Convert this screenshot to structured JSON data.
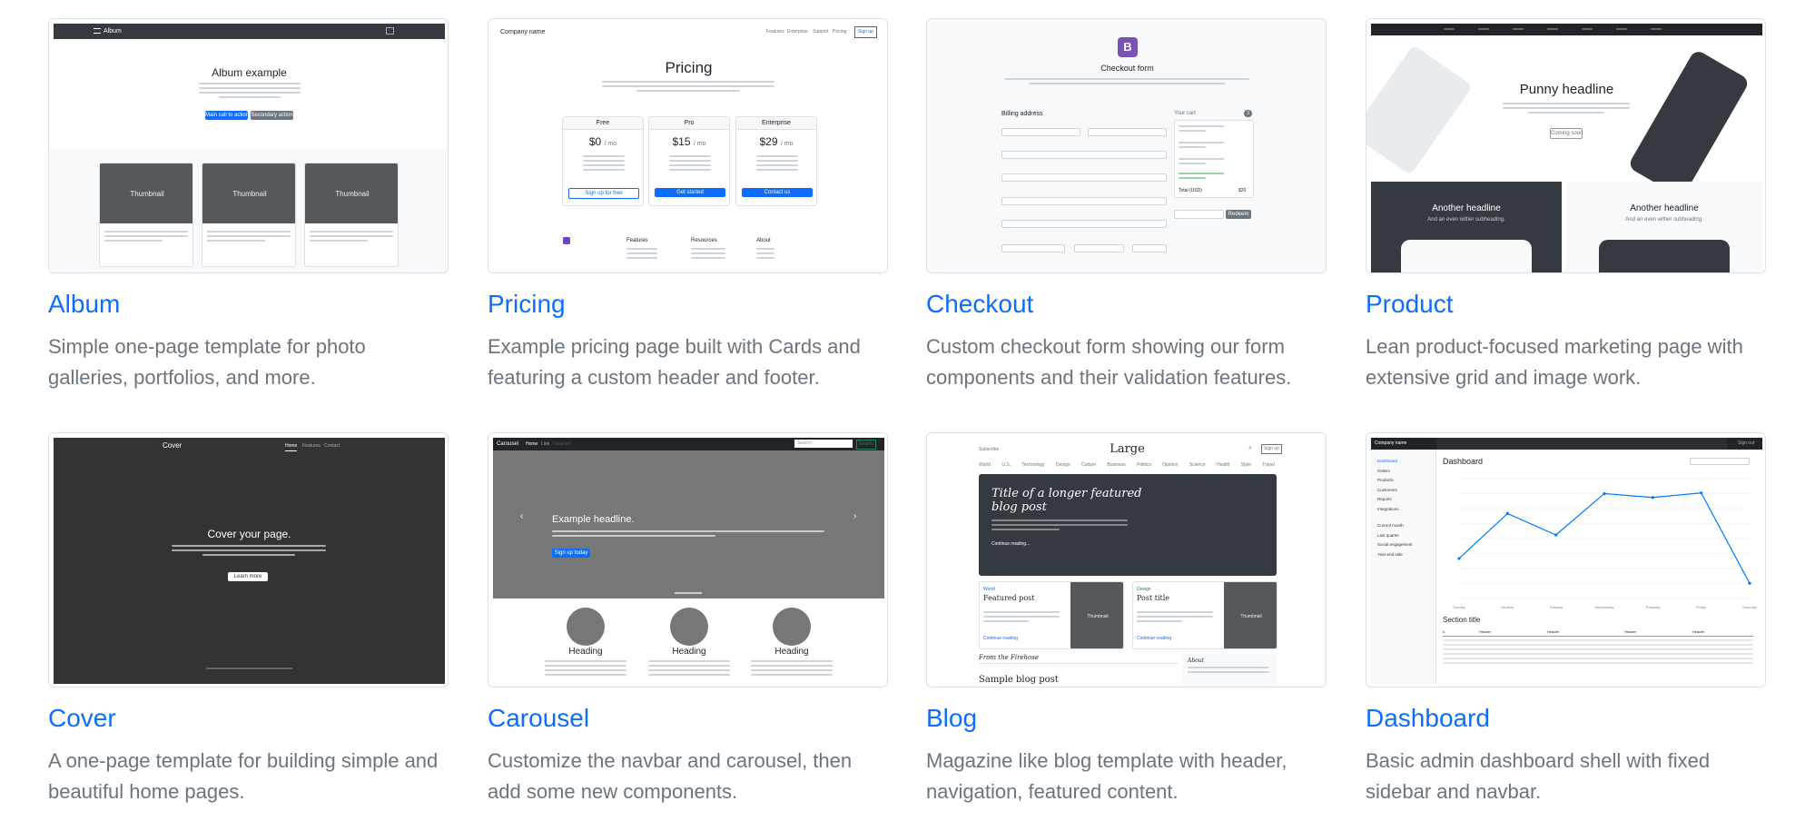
{
  "templates": [
    {
      "title": "Album",
      "description": "Simple one-page template for photo galleries, portfolios, and more."
    },
    {
      "title": "Pricing",
      "description": "Example pricing page built with Cards and featuring a custom header and footer."
    },
    {
      "title": "Checkout",
      "description": "Custom checkout form showing our form components and their validation features."
    },
    {
      "title": "Product",
      "description": "Lean product-focused marketing page with extensive grid and image work."
    },
    {
      "title": "Cover",
      "description": "A one-page template for building simple and beautiful home pages."
    },
    {
      "title": "Carousel",
      "description": "Customize the navbar and carousel, then add some new components."
    },
    {
      "title": "Blog",
      "description": "Magazine like blog template with header, navigation, featured content."
    },
    {
      "title": "Dashboard",
      "description": "Basic admin dashboard shell with fixed sidebar and navbar."
    }
  ],
  "previews": {
    "album": {
      "brand": "Album",
      "heading": "Album example",
      "btn1": "Main call to action",
      "btn2": "Secondary action",
      "thumb_label": "Thumbnail"
    },
    "pricing": {
      "brand": "Company name",
      "nav": [
        "Features",
        "Enterprise",
        "Support",
        "Pricing"
      ],
      "signup": "Sign up",
      "heading": "Pricing",
      "plans": [
        {
          "name": "Free",
          "price": "$0",
          "per": "/ mo",
          "cta": "Sign up for free"
        },
        {
          "name": "Pro",
          "price": "$15",
          "per": "/ mo",
          "cta": "Get started"
        },
        {
          "name": "Enterprise",
          "price": "$29",
          "per": "/ mo",
          "cta": "Contact us"
        }
      ],
      "footer": [
        "Features",
        "Resources",
        "About"
      ]
    },
    "checkout": {
      "heading": "Checkout form",
      "billing": "Billing address",
      "cart": "Your cart",
      "cart_count": "3",
      "total_label": "Total (USD)",
      "total": "$20",
      "redeem": "Redeem"
    },
    "product": {
      "heading": "Punny headline",
      "btn": "Coming soon",
      "h1": "Another headline",
      "h2": "Another headline",
      "sub": "And an even wittier subheading."
    },
    "cover": {
      "brand": "Cover",
      "nav": [
        "Home",
        "Features",
        "Contact"
      ],
      "heading": "Cover your page.",
      "btn": "Learn more"
    },
    "carousel": {
      "brand": "Carousel",
      "nav": [
        "Home",
        "Link",
        "Disabled"
      ],
      "search": "Search",
      "search_btn": "Search",
      "headline": "Example headline.",
      "btn": "Sign up today",
      "heading": "Heading"
    },
    "blog": {
      "brand": "Large",
      "subscribe": "Subscribe",
      "signup": "Sign up",
      "nav": [
        "World",
        "U.S.",
        "Technology",
        "Design",
        "Culture",
        "Business",
        "Politics",
        "Opinion",
        "Science",
        "Health",
        "Style",
        "Travel"
      ],
      "hero_title": "Title of a longer featured blog post",
      "hero_link": "Continue reading...",
      "post1_tag": "World",
      "post1": "Featured post",
      "post2_tag": "Design",
      "post2": "Post title",
      "thumb": "Thumbnail",
      "continue": "Continue reading",
      "firehose": "From the Firehose",
      "sample": "Sample blog post",
      "about": "About"
    },
    "dashboard": {
      "brand": "Company name",
      "signout": "Sign out",
      "heading": "Dashboard",
      "section": "Section title",
      "sidebar": [
        "Dashboard",
        "Orders",
        "Products",
        "Customers",
        "Reports",
        "Integrations"
      ],
      "saved": [
        "Current month",
        "Last quarter",
        "Social engagement",
        "Year-end sale"
      ],
      "header_cells": [
        "#",
        "Header",
        "Header",
        "Header",
        "Header"
      ],
      "days": [
        "Sunday",
        "Monday",
        "Tuesday",
        "Wednesday",
        "Thursday",
        "Friday",
        "Saturday"
      ],
      "chart_values": [
        15339,
        21345,
        18483,
        24003,
        23489,
        24092,
        12034
      ]
    }
  },
  "colors": {
    "link": "#0d6efd",
    "muted": "#6c757d",
    "border": "#dee2e6",
    "dark": "#343a40",
    "gray_thumb": "#55595c"
  }
}
